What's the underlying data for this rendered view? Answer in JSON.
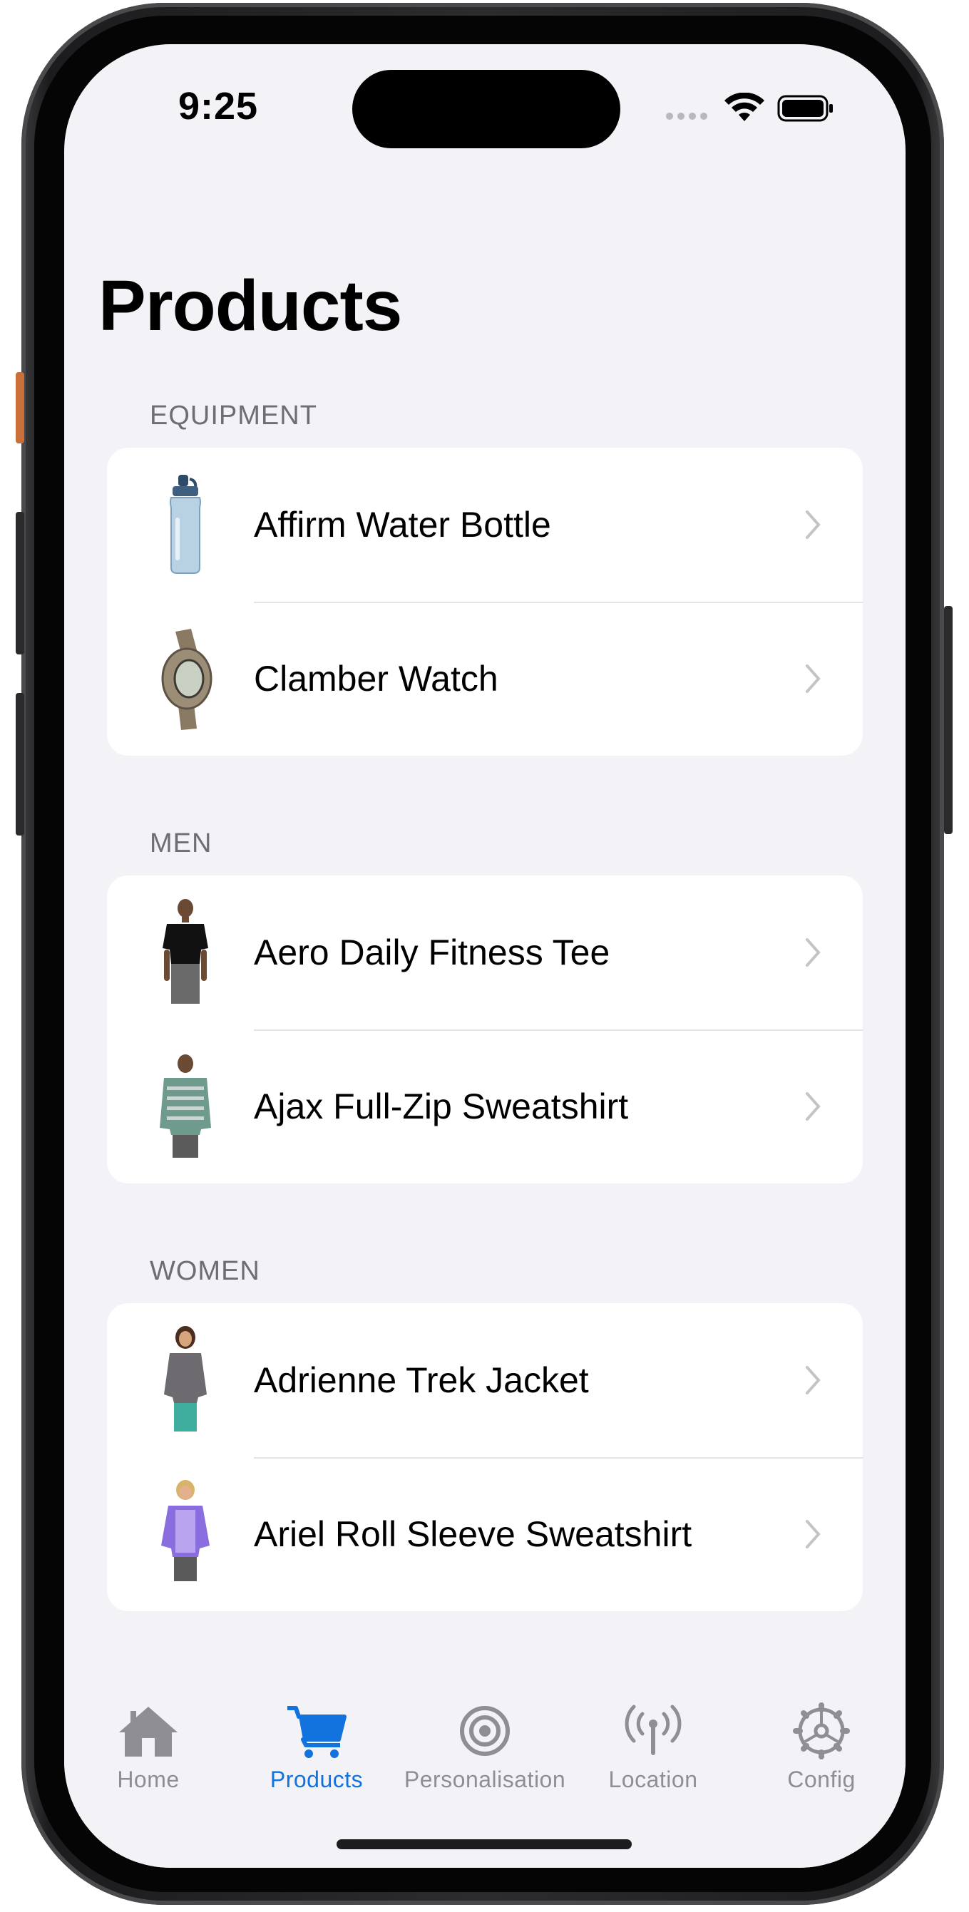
{
  "status": {
    "time": "9:25",
    "icons": [
      "cellular-dots-icon",
      "wifi-icon",
      "battery-icon"
    ]
  },
  "page": {
    "title": "Products"
  },
  "sections": [
    {
      "header": "EQUIPMENT",
      "items": [
        {
          "label": "Affirm Water Bottle",
          "thumb": "water-bottle-image"
        },
        {
          "label": "Clamber Watch",
          "thumb": "watch-image"
        }
      ]
    },
    {
      "header": "MEN",
      "items": [
        {
          "label": "Aero Daily Fitness Tee",
          "thumb": "man-black-tee-image"
        },
        {
          "label": "Ajax Full-Zip Sweatshirt",
          "thumb": "man-striped-sweatshirt-image"
        }
      ]
    },
    {
      "header": "WOMEN",
      "items": [
        {
          "label": "Adrienne Trek Jacket",
          "thumb": "woman-grey-jacket-image"
        },
        {
          "label": "Ariel Roll Sleeve Sweatshirt",
          "thumb": "woman-purple-sweatshirt-image"
        }
      ]
    }
  ],
  "tabs": [
    {
      "label": "Home",
      "icon": "house-icon",
      "active": false
    },
    {
      "label": "Products",
      "icon": "cart-icon",
      "active": true
    },
    {
      "label": "Personalisation",
      "icon": "target-icon",
      "active": false
    },
    {
      "label": "Location",
      "icon": "antenna-icon",
      "active": false
    },
    {
      "label": "Config",
      "icon": "gear-icon",
      "active": false
    }
  ],
  "colors": {
    "accent": "#1272de",
    "background": "#f2f2f7",
    "inactive_tab": "#8e8e93",
    "section_header": "#6d6d72"
  }
}
